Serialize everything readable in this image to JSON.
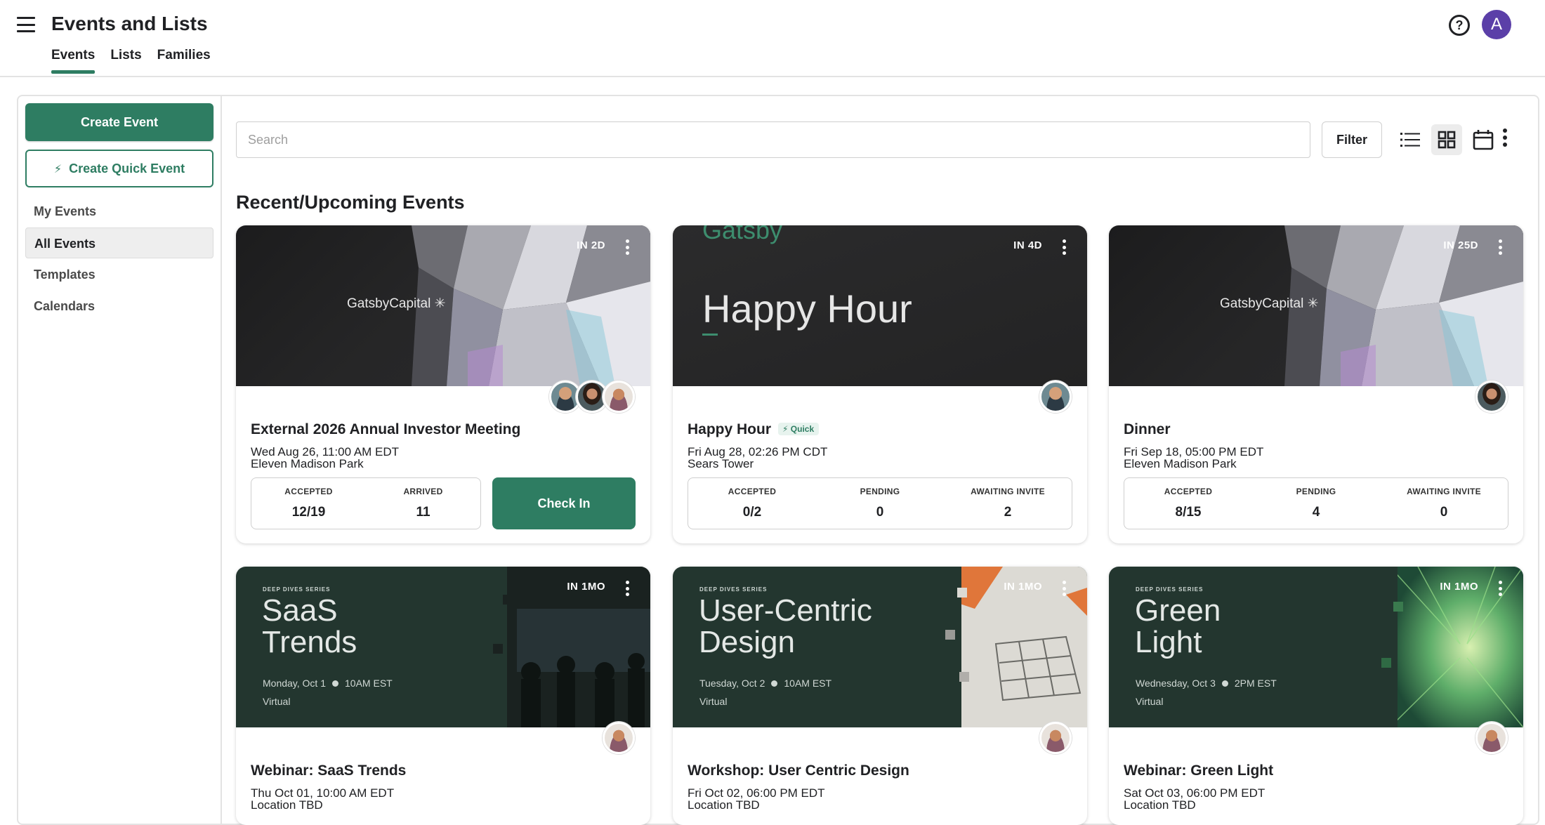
{
  "header": {
    "title": "Events and Lists",
    "tabs": [
      {
        "label": "Events",
        "active": true
      },
      {
        "label": "Lists",
        "active": false
      },
      {
        "label": "Families",
        "active": false
      }
    ],
    "help_icon": "help-circle-icon",
    "avatar_initial": "A"
  },
  "sidebar": {
    "create_event": "Create Event",
    "create_quick_event": "Create Quick Event",
    "nav": [
      {
        "label": "My Events",
        "active": false
      },
      {
        "label": "All Events",
        "active": true
      },
      {
        "label": "Templates",
        "active": false
      },
      {
        "label": "Calendars",
        "active": false
      }
    ]
  },
  "toolbar": {
    "search_placeholder": "Search",
    "search_value": "",
    "filter_label": "Filter",
    "views": [
      "list-view-icon",
      "grid-view-icon",
      "calendar-view-icon"
    ],
    "active_view": "grid"
  },
  "section_title": "Recent/Upcoming Events",
  "events": [
    {
      "countdown": "IN 2D",
      "image_text": "GatsbyCapital ✳",
      "title": "External 2026 Annual Investor Meeting",
      "date": "Wed Aug 26, 11:00 AM EDT",
      "location": "Eleven Madison Park",
      "stats": [
        {
          "label": "ACCEPTED",
          "value": "12/19"
        },
        {
          "label": "ARRIVED",
          "value": "11"
        }
      ],
      "action": "Check In"
    },
    {
      "countdown": "IN 4D",
      "image_text": "Happy Hour",
      "image_brand": "Gatsby",
      "title": "Happy Hour",
      "badge": "Quick",
      "date": "Fri Aug 28, 02:26 PM CDT",
      "location": "Sears Tower",
      "stats": [
        {
          "label": "ACCEPTED",
          "value": "0/2"
        },
        {
          "label": "PENDING",
          "value": "0"
        },
        {
          "label": "AWAITING INVITE",
          "value": "2"
        }
      ]
    },
    {
      "countdown": "IN 25D",
      "image_text": "GatsbyCapital ✳",
      "title": "Dinner",
      "date": "Fri Sep 18, 05:00 PM EDT",
      "location": "Eleven Madison Park",
      "stats": [
        {
          "label": "ACCEPTED",
          "value": "8/15"
        },
        {
          "label": "PENDING",
          "value": "4"
        },
        {
          "label": "AWAITING INVITE",
          "value": "0"
        }
      ]
    },
    {
      "countdown": "IN 1MO",
      "series": "DEEP DIVES SERIES",
      "image_line1": "SaaS",
      "image_line2": "Trends",
      "image_day": "Monday, Oct 1",
      "image_time": "10AM EST",
      "image_mode": "Virtual",
      "title": "Webinar: SaaS Trends",
      "date": "Thu Oct 01, 10:00 AM EDT",
      "location": "Location TBD"
    },
    {
      "countdown": "IN 1MO",
      "series": "DEEP DIVES SERIES",
      "image_line1": "User-Centric",
      "image_line2": "Design",
      "image_day": "Tuesday, Oct 2",
      "image_time": "10AM EST",
      "image_mode": "Virtual",
      "title": "Workshop: User Centric Design",
      "date": "Fri Oct 02, 06:00 PM EDT",
      "location": "Location TBD"
    },
    {
      "countdown": "IN 1MO",
      "series": "DEEP DIVES SERIES",
      "image_line1": "Green",
      "image_line2": "Light",
      "image_day": "Wednesday, Oct 3",
      "image_time": "2PM EST",
      "image_mode": "Virtual",
      "title": "Webinar: Green Light",
      "date": "Sat Oct 03, 06:00 PM EDT",
      "location": "Location TBD"
    }
  ],
  "colors": {
    "accent": "#2e7d62",
    "avatar_bg": "#5b3fa8",
    "card_dark": "#23362f"
  }
}
